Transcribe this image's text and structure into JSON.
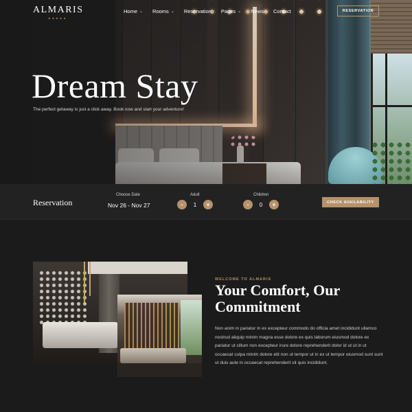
{
  "brand": {
    "name": "ALMARIS",
    "stars": "★★★★★"
  },
  "nav": {
    "items": [
      {
        "label": "Home",
        "has_dropdown": true
      },
      {
        "label": "Rooms",
        "has_dropdown": true
      },
      {
        "label": "Reservation",
        "has_dropdown": false
      },
      {
        "label": "Pages",
        "has_dropdown": true
      },
      {
        "label": "News",
        "has_dropdown": false
      },
      {
        "label": "Contact",
        "has_dropdown": false
      }
    ],
    "chevron": "⌄",
    "cta_label": "RESERVATION"
  },
  "hero": {
    "title": "Dream Stay",
    "subtitle": "The perfect getaway is just a click away. Book now and start your adventure!"
  },
  "reservation": {
    "title": "Reservation",
    "date_label": "Choose Date",
    "date_value": "Nov 26 - Nov 27",
    "adult_label": "Adult",
    "adult_value": "1",
    "children_label": "Children",
    "children_value": "0",
    "minus": "-",
    "plus": "+",
    "check_label": "CHECK AVAILABILITY"
  },
  "about": {
    "eyebrow": "WELCOME TO ALMARIS",
    "title": "Your Comfort, Our Commitment",
    "text": "Non anim in pariatur in ex excepteur commodo do officia amet incididunt ullamco nostrud aliquip minim magna esse dolore ex quis laborum eiusmod dolore ex pariatur ut cillum non excepteur irure dolore reprehenderit dolor id ut ut in ut occaecat culpa minim dolore elit non ut tempor ut in ex ut tempor eiusmod sunt sunt ut duis aute in occaecat reprehenderit sit quis incididunt."
  },
  "colors": {
    "accent": "#b5926a",
    "background": "#1b1b1b",
    "bar": "#232222"
  }
}
